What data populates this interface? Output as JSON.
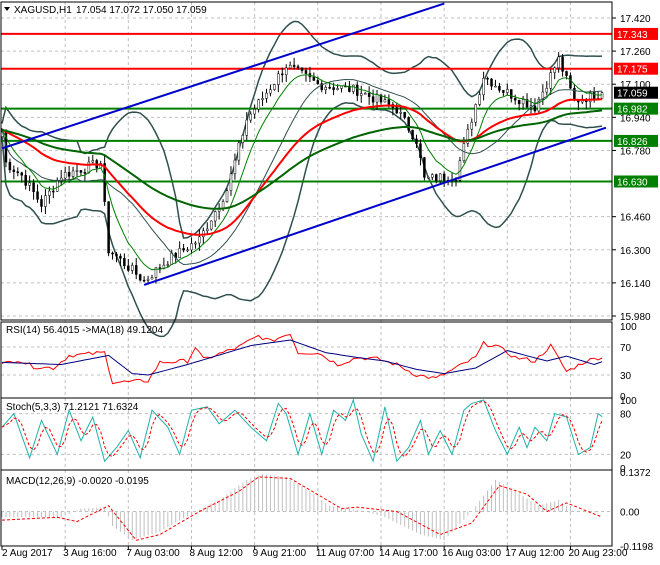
{
  "chart_data": {
    "type": "line",
    "title": "XAGUSD,H1",
    "ohlc_header": "17.054 17.072 17.050 17.059",
    "current_price": "17.059",
    "price_axis": {
      "ylim": [
        15.98,
        17.42
      ],
      "ticks": [
        "17.420",
        "17.260",
        "17.100",
        "16.940",
        "16.780",
        "16.460",
        "16.300",
        "16.140",
        "15.980"
      ]
    },
    "x_ticks": [
      {
        "bar": 0,
        "label": "2 Aug 2017"
      },
      {
        "bar": 16,
        "label": "3 Aug 16:00"
      },
      {
        "bar": 32,
        "label": "7 Aug 03:00"
      },
      {
        "bar": 48,
        "label": "8 Aug 12:00"
      },
      {
        "bar": 64,
        "label": "9 Aug 21:00"
      },
      {
        "bar": 80,
        "label": "11 Aug 07:00"
      },
      {
        "bar": 96,
        "label": "14 Aug 17:00"
      },
      {
        "bar": 112,
        "label": "16 Aug 03:00"
      },
      {
        "bar": 128,
        "label": "17 Aug 12:00"
      },
      {
        "bar": 144,
        "label": "20 Aug 23:00"
      }
    ],
    "bars": 153,
    "close_keypoints": [
      [
        0,
        16.88
      ],
      [
        1,
        16.72
      ],
      [
        5,
        16.66
      ],
      [
        10,
        16.52
      ],
      [
        15,
        16.66
      ],
      [
        25,
        16.72
      ],
      [
        27,
        16.3
      ],
      [
        36,
        16.15
      ],
      [
        42,
        16.25
      ],
      [
        50,
        16.35
      ],
      [
        57,
        16.59
      ],
      [
        62,
        16.93
      ],
      [
        72,
        17.19
      ],
      [
        80,
        17.1
      ],
      [
        90,
        17.07
      ],
      [
        100,
        16.98
      ],
      [
        105,
        16.83
      ],
      [
        107,
        16.64
      ],
      [
        115,
        16.66
      ],
      [
        122,
        17.14
      ],
      [
        127,
        17.07
      ],
      [
        135,
        16.99
      ],
      [
        141,
        17.22
      ],
      [
        145,
        17.02
      ],
      [
        152,
        17.059
      ]
    ],
    "levels": [
      {
        "price": 17.343,
        "label": "17.343",
        "color": "#ff0000"
      },
      {
        "price": 17.175,
        "label": "17.175",
        "color": "#ff0000"
      },
      {
        "price": 16.982,
        "label": "16.982",
        "color": "#008000"
      },
      {
        "price": 16.826,
        "label": "16.826",
        "color": "#008000"
      },
      {
        "price": 16.63,
        "label": "16.630",
        "color": "#008000"
      }
    ],
    "trendlines": [
      {
        "name": "upper-channel",
        "points": [
          [
            0,
            16.79
          ],
          [
            112,
            17.49
          ]
        ],
        "color": "#0000cc"
      },
      {
        "name": "lower-channel",
        "points": [
          [
            36,
            16.13
          ],
          [
            153,
            16.89
          ]
        ],
        "color": "#0000cc"
      }
    ],
    "rsi": {
      "label": "RSI(14) 56.4015  ->MA(18) 49.1204",
      "ticks": [
        "100",
        "70",
        "30",
        "0"
      ],
      "values": [
        [
          0,
          45
        ],
        [
          4,
          52
        ],
        [
          8,
          42
        ],
        [
          13,
          40
        ],
        [
          17,
          58
        ],
        [
          22,
          60
        ],
        [
          26,
          62
        ],
        [
          28,
          20
        ],
        [
          32,
          20
        ],
        [
          37,
          22
        ],
        [
          40,
          48
        ],
        [
          47,
          50
        ],
        [
          49,
          70
        ],
        [
          51,
          52
        ],
        [
          60,
          70
        ],
        [
          65,
          86
        ],
        [
          68,
          78
        ],
        [
          73,
          90
        ],
        [
          75,
          62
        ],
        [
          80,
          62
        ],
        [
          85,
          45
        ],
        [
          90,
          55
        ],
        [
          95,
          53
        ],
        [
          100,
          45
        ],
        [
          105,
          30
        ],
        [
          110,
          25
        ],
        [
          115,
          40
        ],
        [
          120,
          55
        ],
        [
          122,
          75
        ],
        [
          125,
          72
        ],
        [
          130,
          55
        ],
        [
          135,
          50
        ],
        [
          139,
          72
        ],
        [
          143,
          35
        ],
        [
          148,
          50
        ],
        [
          152,
          56
        ]
      ],
      "ma": [
        [
          0,
          48
        ],
        [
          15,
          45
        ],
        [
          27,
          58
        ],
        [
          33,
          32
        ],
        [
          37,
          30
        ],
        [
          47,
          45
        ],
        [
          63,
          72
        ],
        [
          73,
          80
        ],
        [
          82,
          62
        ],
        [
          90,
          55
        ],
        [
          97,
          50
        ],
        [
          105,
          38
        ],
        [
          112,
          32
        ],
        [
          120,
          40
        ],
        [
          128,
          65
        ],
        [
          138,
          50
        ],
        [
          143,
          57
        ],
        [
          150,
          45
        ],
        [
          152,
          49
        ]
      ]
    },
    "stoch": {
      "label": "Stoch(5,3,3) 71.2121 71.6324",
      "ticks": [
        "100",
        "80",
        "20",
        "0"
      ],
      "values": [
        [
          0,
          60
        ],
        [
          3,
          80
        ],
        [
          7,
          15
        ],
        [
          10,
          70
        ],
        [
          14,
          20
        ],
        [
          17,
          85
        ],
        [
          20,
          40
        ],
        [
          23,
          75
        ],
        [
          26,
          10
        ],
        [
          29,
          30
        ],
        [
          32,
          55
        ],
        [
          35,
          15
        ],
        [
          38,
          85
        ],
        [
          42,
          60
        ],
        [
          45,
          20
        ],
        [
          48,
          85
        ],
        [
          52,
          90
        ],
        [
          55,
          65
        ],
        [
          59,
          85
        ],
        [
          63,
          60
        ],
        [
          67,
          40
        ],
        [
          70,
          95
        ],
        [
          72,
          80
        ],
        [
          75,
          20
        ],
        [
          78,
          80
        ],
        [
          81,
          20
        ],
        [
          84,
          85
        ],
        [
          87,
          70
        ],
        [
          89,
          100
        ],
        [
          91,
          50
        ],
        [
          94,
          10
        ],
        [
          97,
          90
        ],
        [
          100,
          10
        ],
        [
          103,
          30
        ],
        [
          106,
          70
        ],
        [
          108,
          20
        ],
        [
          111,
          55
        ],
        [
          114,
          20
        ],
        [
          117,
          85
        ],
        [
          119,
          95
        ],
        [
          122,
          100
        ],
        [
          125,
          55
        ],
        [
          128,
          20
        ],
        [
          131,
          60
        ],
        [
          133,
          30
        ],
        [
          135,
          60
        ],
        [
          138,
          40
        ],
        [
          140,
          80
        ],
        [
          143,
          75
        ],
        [
          146,
          20
        ],
        [
          149,
          30
        ],
        [
          151,
          80
        ],
        [
          153,
          71
        ]
      ]
    },
    "macd": {
      "label": "MACD(12,26,9) -0.0020 -0.0195",
      "ticks": [
        "0.1372",
        "0.00",
        "-0.1198"
      ],
      "ylim": [
        -0.1198,
        0.1372
      ],
      "histogram": [
        [
          0,
          -0.02
        ],
        [
          15,
          -0.02
        ],
        [
          20,
          0.01
        ],
        [
          26,
          0.015
        ],
        [
          28,
          -0.05
        ],
        [
          33,
          -0.1
        ],
        [
          40,
          -0.07
        ],
        [
          49,
          0.0
        ],
        [
          55,
          0.04
        ],
        [
          62,
          0.11
        ],
        [
          66,
          0.13
        ],
        [
          72,
          0.12
        ],
        [
          77,
          0.08
        ],
        [
          83,
          0.02
        ],
        [
          92,
          0.0
        ],
        [
          97,
          -0.02
        ],
        [
          106,
          -0.08
        ],
        [
          112,
          -0.1
        ],
        [
          119,
          0.0
        ],
        [
          125,
          0.11
        ],
        [
          129,
          0.08
        ],
        [
          136,
          0.02
        ],
        [
          141,
          0.04
        ],
        [
          145,
          0.0
        ],
        [
          152,
          -0.002
        ]
      ],
      "signal": [
        [
          0,
          -0.03
        ],
        [
          14,
          -0.02
        ],
        [
          19,
          -0.035
        ],
        [
          27,
          0.02
        ],
        [
          34,
          -0.1
        ],
        [
          40,
          -0.08
        ],
        [
          50,
          0.0
        ],
        [
          60,
          0.07
        ],
        [
          65,
          0.12
        ],
        [
          73,
          0.115
        ],
        [
          86,
          0.01
        ],
        [
          90,
          0.015
        ],
        [
          100,
          0.0
        ],
        [
          111,
          -0.08
        ],
        [
          119,
          -0.04
        ],
        [
          126,
          0.09
        ],
        [
          133,
          0.06
        ],
        [
          138,
          0.0
        ],
        [
          143,
          0.03
        ],
        [
          152,
          -0.0195
        ]
      ]
    },
    "colors": {
      "bull": "#000000",
      "ma_fast": "#008000",
      "ma_mid": "#ff0000",
      "ma_slow": "#006400",
      "bands": "#2f4f4f",
      "rsi": "#ff0000",
      "rsi_ma": "#000080",
      "stoch_main": "#20b2aa",
      "stoch_signal": "#ff0000",
      "macd_hist": "#c0c0c0"
    }
  }
}
